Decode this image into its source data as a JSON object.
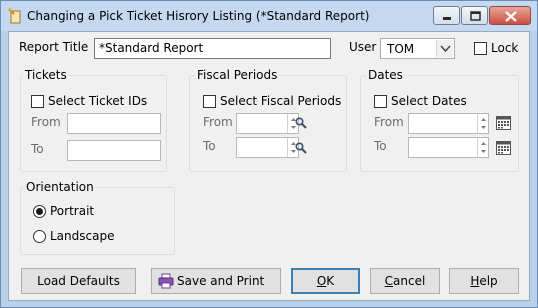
{
  "window": {
    "title": "Changing a Pick Ticket Hisrory Listing  (*Standard Report)"
  },
  "icons": {
    "app": "pick-ticket-icon",
    "minimize": "minimize-icon",
    "maximize": "maximize-icon",
    "close": "close-icon",
    "search": "magnifier-icon",
    "calendar": "calendar-icon",
    "print": "printer-icon"
  },
  "report": {
    "label": "Report Title",
    "value": "*Standard Report"
  },
  "user": {
    "label": "User",
    "value": "TOM"
  },
  "lock": {
    "label": "Lock",
    "checked": false
  },
  "tickets": {
    "title": "Tickets",
    "select_label": "Select Ticket IDs",
    "checked": false,
    "from_label": "From",
    "from_value": "",
    "to_label": "To",
    "to_value": ""
  },
  "fiscal": {
    "title": "Fiscal Periods",
    "select_label": "Select Fiscal Periods",
    "checked": false,
    "from_label": "From",
    "from_value": "",
    "to_label": "To",
    "to_value": ""
  },
  "dates": {
    "title": "Dates",
    "select_label": "Select Dates",
    "checked": false,
    "from_label": "From",
    "from_value": "",
    "to_label": "To",
    "to_value": ""
  },
  "orientation": {
    "title": "Orientation",
    "portrait_label": "Portrait",
    "landscape_label": "Landscape",
    "selected": "Portrait"
  },
  "buttons": {
    "load_defaults": "Load Defaults",
    "save_print": "Save and Print",
    "ok_prefix": "",
    "ok_mnemonic": "O",
    "ok_rest": "K",
    "cancel_mnemonic": "C",
    "cancel_rest": "ancel",
    "help_mnemonic": "H",
    "help_rest": "elp"
  },
  "colors": {
    "titlebar": "#c4d9ef",
    "dialog": "#f0f0f0",
    "default_button_border": "#3c7fb1",
    "close_button": "#c9503f"
  }
}
